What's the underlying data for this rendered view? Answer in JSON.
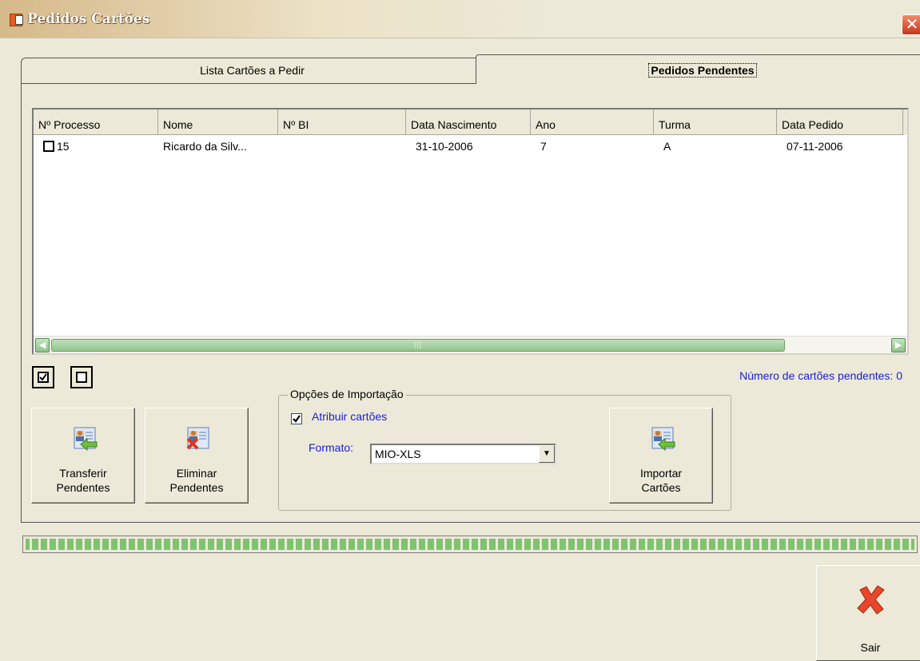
{
  "window": {
    "title": "Pedidos Cartões",
    "close_glyph": "✕"
  },
  "tabs": [
    {
      "label": "Lista Cartões a Pedir",
      "active": false
    },
    {
      "label": "Pedidos Pendentes",
      "active": true
    }
  ],
  "table": {
    "columns": [
      "Nº Processo",
      "Nome",
      "Nº BI",
      "Data Nascimento",
      "Ano",
      "Turma",
      "Data Pedido"
    ],
    "rows": [
      {
        "processo": "15",
        "nome": "Ricardo da Silv...",
        "bi": "",
        "nascimento": "31-10-2006",
        "ano": "7",
        "turma": "A",
        "pedido": "07-11-2006",
        "checked": false
      }
    ]
  },
  "count_label": "Número de cartões pendentes: 0",
  "buttons": {
    "transferir": "Transferir\nPendentes",
    "eliminar": "Eliminar\nPendentes",
    "importar": "Importar\nCartões",
    "sair": "Sair"
  },
  "import_options": {
    "title": "Opções de Importação",
    "atribuir_label": "Atribuir cartões",
    "atribuir_checked": true,
    "formato_label": "Formato:",
    "formato_value": "MIO-XLS"
  },
  "progress_fraction": 1.0,
  "colors": {
    "label_blue": "#1a20d9",
    "progress_green": "#7fc36f",
    "face": "#ece9d8"
  }
}
